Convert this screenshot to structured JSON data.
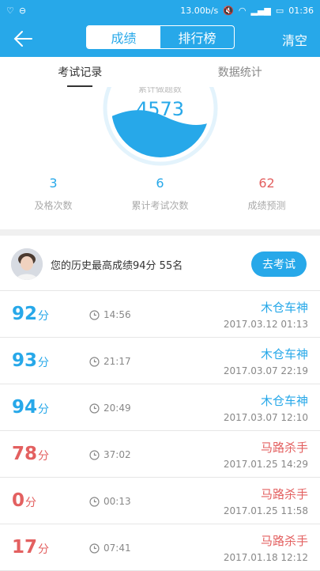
{
  "status": {
    "speed": "13.00b/s",
    "time": "01:36"
  },
  "nav": {
    "tabs": [
      "成绩",
      "排行榜"
    ],
    "clear_label": "清空"
  },
  "subtabs": [
    "考试记录",
    "数据统计"
  ],
  "gauge": {
    "label": "累计做题数",
    "value": "4573"
  },
  "stats": [
    {
      "value": "3",
      "label": "及格次数"
    },
    {
      "value": "6",
      "label": "累计考试次数"
    },
    {
      "value": "62",
      "label": "成绩预测"
    }
  ],
  "best": {
    "text": "您的历史最高成绩94分  55名",
    "button": "去考试"
  },
  "unit": "分",
  "records": [
    {
      "score": "92",
      "duration": "14:56",
      "name": "木仓车神",
      "datetime": "2017.03.12  01:13",
      "color": "#27a8e9"
    },
    {
      "score": "93",
      "duration": "21:17",
      "name": "木仓车神",
      "datetime": "2017.03.07  22:19",
      "color": "#27a8e9"
    },
    {
      "score": "94",
      "duration": "20:49",
      "name": "木仓车神",
      "datetime": "2017.03.07  12:10",
      "color": "#27a8e9"
    },
    {
      "score": "78",
      "duration": "37:02",
      "name": "马路杀手",
      "datetime": "2017.01.25  14:29",
      "color": "#e36060"
    },
    {
      "score": "0",
      "duration": "00:13",
      "name": "马路杀手",
      "datetime": "2017.01.25  11:58",
      "color": "#e36060"
    },
    {
      "score": "17",
      "duration": "07:41",
      "name": "马路杀手",
      "datetime": "2017.01.18  12:12",
      "color": "#e36060"
    }
  ]
}
